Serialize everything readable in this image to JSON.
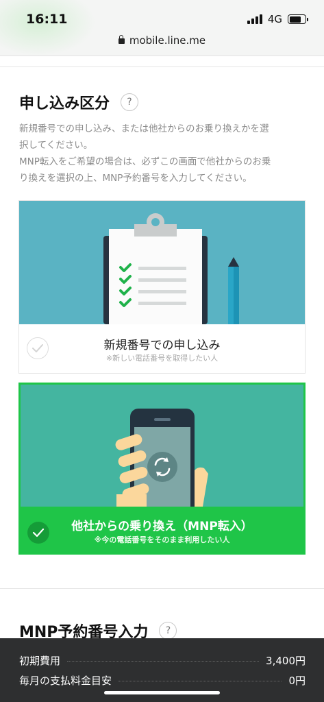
{
  "status_bar": {
    "time": "16:11",
    "network": "4G",
    "battery_level": 0.75
  },
  "browser": {
    "url": "mobile.line.me"
  },
  "section1": {
    "title": "申し込み区分",
    "help": "?",
    "description_line1": "新規番号での申し込み、または他社からのお乗り換えかを選",
    "description_line2": "択してください。",
    "description_line3": "MNP転入をご希望の場合は、必ずこの画面で他社からのお乗",
    "description_line4": "り換えを選択の上、MNP予約番号を入力してください。"
  },
  "options": [
    {
      "title": "新規番号での申し込み",
      "subtitle": "※新しい電話番号を取得したい人",
      "selected": false
    },
    {
      "title": "他社からの乗り換え（MNP転入）",
      "subtitle": "※今の電話番号をそのまま利用したい人",
      "selected": true
    }
  ],
  "section2": {
    "title": "MNP予約番号入力",
    "help": "?"
  },
  "summary": {
    "initial_cost_label": "初期費用",
    "initial_cost_value": "3,400円",
    "monthly_label": "毎月の支払料金目安",
    "monthly_value": "0円"
  },
  "colors": {
    "line_green": "#1fc548",
    "illustration_blue": "#5ab3c3",
    "illustration_teal": "#44b5a0",
    "summary_bg": "#2e2f30"
  }
}
